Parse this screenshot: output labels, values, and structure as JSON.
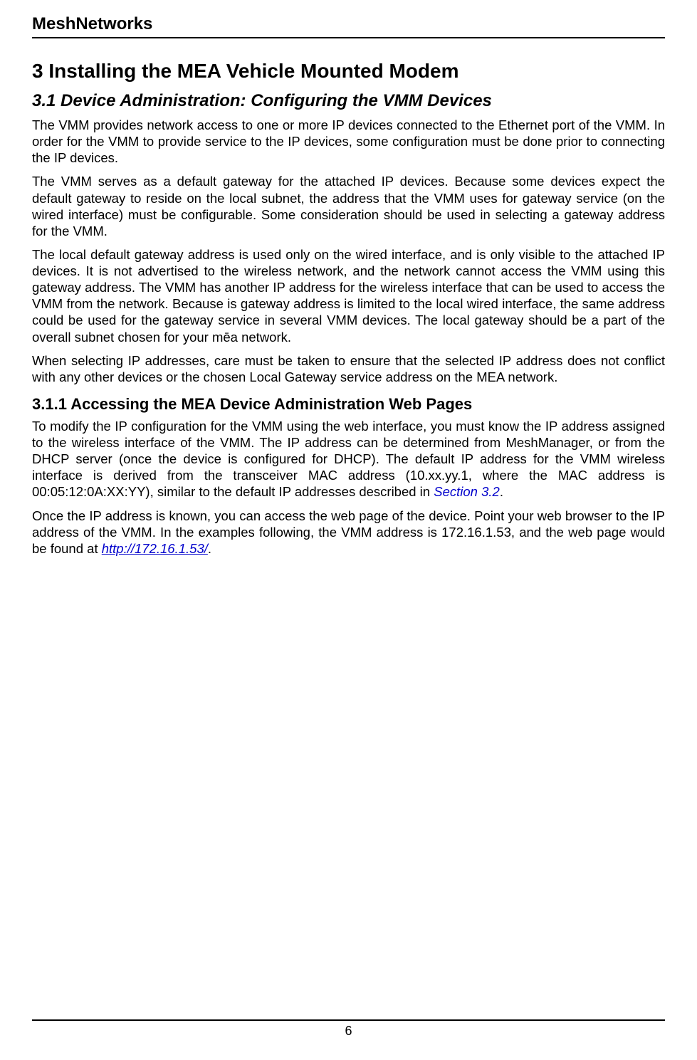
{
  "header": {
    "title": "MeshNetworks"
  },
  "section": {
    "h1": "3  Installing the MEA Vehicle Mounted Modem",
    "h2": "3.1    Device Administration: Configuring the VMM Devices",
    "p1": "The VMM provides network access to one or more IP devices connected to the Ethernet port of the VMM. In order for the VMM to provide service to the IP devices, some configuration must be done prior to connecting the IP devices.",
    "p2": "The VMM serves as a default gateway for the attached IP devices. Because some devices expect the default gateway to reside on the local subnet, the address that the VMM uses for gateway service (on the wired interface) must be configurable. Some consideration should be used in selecting a gateway address for the VMM.",
    "p3": "The local default gateway address is used only on the wired interface, and is only visible to the attached IP devices.  It is not advertised to the wireless network, and the network cannot access the VMM using this gateway address. The VMM has another IP address for the wireless interface that can be used to access the VMM from the network. Because is gateway address is limited to the local wired interface, the same address could be used for the gateway service in several VMM devices. The local gateway should be a part of the overall subnet chosen for your mēa network.",
    "p4": "When selecting IP addresses, care must be taken to ensure that the selected IP address does not conflict with any other devices or the chosen Local Gateway service address on the MEA network.",
    "h3": "3.1.1  Accessing the MEA Device Administration Web Pages",
    "p5_part1": "To modify the IP configuration for the VMM using the web interface, you must know the IP address assigned to the wireless interface of the VMM.  The IP address can be determined from MeshManager, or from the DHCP server (once the device is configured for DHCP). The default IP address for the VMM wireless interface is derived from the transceiver MAC address (10.xx.yy.1, where the MAC address is 00:05:12:0A:XX:YY), similar to the default IP addresses described in ",
    "p5_link": "Section 3.2",
    "p5_part2": ".",
    "p6_part1": "Once the IP address is known, you can access the web page of the device.  Point your web browser to the IP address of the VMM.  In the examples following, the VMM address is 172.16.1.53, and the web page would be found at ",
    "p6_link": "http://172.16.1.53/",
    "p6_part2": "."
  },
  "footer": {
    "page_number": "6"
  }
}
